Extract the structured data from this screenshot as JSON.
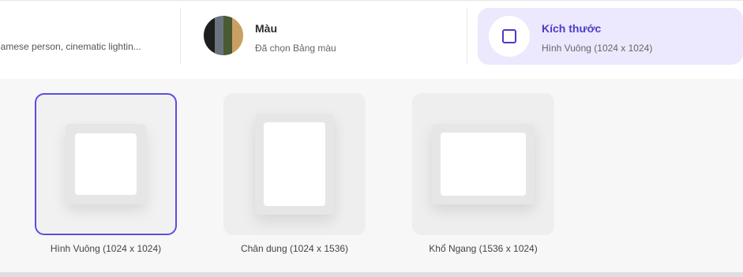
{
  "toolbar": {
    "prompt_preview": "namese person, cinematic lightin...",
    "color": {
      "title": "Màu",
      "subtitle": "Đã chọn Bảng màu",
      "swatches": [
        "#1e1e1e",
        "#6a7480",
        "#4a5a32",
        "#c9a063"
      ],
      "swatch_icon": "color-palette-swatch"
    },
    "size": {
      "title": "Kích thước",
      "subtitle": "Hình Vuông (1024 x 1024)",
      "icon": "square-icon",
      "accent": "#4b3bc9",
      "background": "#ece8fd"
    }
  },
  "size_options": [
    {
      "label": "Hình Vuông (1024 x 1024)",
      "selected": true
    },
    {
      "label": "Chân dung (1024 x 1536)",
      "selected": false
    },
    {
      "label": "Khổ Ngang (1536 x 1024)",
      "selected": false
    }
  ],
  "colors": {
    "selected_border": "#5b4ee0",
    "panel_bg": "#f7f7f7"
  }
}
